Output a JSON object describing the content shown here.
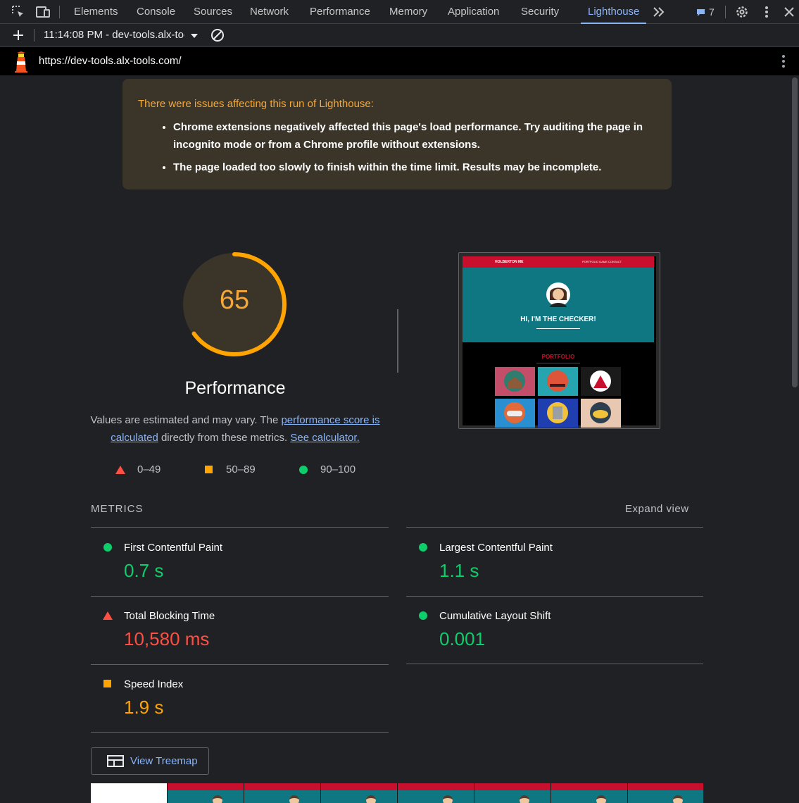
{
  "tabs": [
    "Elements",
    "Console",
    "Sources",
    "Network",
    "Performance",
    "Memory",
    "Application",
    "Security",
    "Lighthouse"
  ],
  "active_tab": "Lighthouse",
  "issues_count": "7",
  "run_selector": "11:14:08 PM - dev-tools.alx-tools.com",
  "url": "https://dev-tools.alx-tools.com/",
  "warning": {
    "title": "There were issues affecting this run of Lighthouse:",
    "items": [
      "Chrome extensions negatively affected this page's load performance. Try auditing the page in incognito mode or from a Chrome profile without extensions.",
      "The page loaded too slowly to finish within the time limit. Results may be incomplete."
    ]
  },
  "score": {
    "value": "65",
    "fraction": 0.65,
    "category": "Performance"
  },
  "description": {
    "prefix": "Values are estimated and may vary. The ",
    "link1": "performance score is calculated",
    "middle": " directly from these metrics. ",
    "link2": "See calculator."
  },
  "legend": {
    "fail": "0–49",
    "average": "50–89",
    "pass": "90–100"
  },
  "thumbnail": {
    "site_logo": "HOLBERTON ME",
    "nav": "PORTFOLIO   GAME   CONTACT",
    "hero_text": "HI, I'M THE CHECKER!",
    "section_title": "PORTFOLIO"
  },
  "metrics": {
    "label": "METRICS",
    "expand": "Expand view",
    "fcp": {
      "name": "First Contentful Paint",
      "value": "0.7 s"
    },
    "lcp": {
      "name": "Largest Contentful Paint",
      "value": "1.1 s"
    },
    "tbt": {
      "name": "Total Blocking Time",
      "value": "10,580 ms"
    },
    "cls": {
      "name": "Cumulative Layout Shift",
      "value": "0.001"
    },
    "si": {
      "name": "Speed Index",
      "value": "1.9 s"
    }
  },
  "treemap_button": "View Treemap",
  "colors": {
    "accent": "#8ab4f8",
    "score_average": "#ffa400",
    "pass": "#0cce6b",
    "fail": "#ff4e42"
  }
}
